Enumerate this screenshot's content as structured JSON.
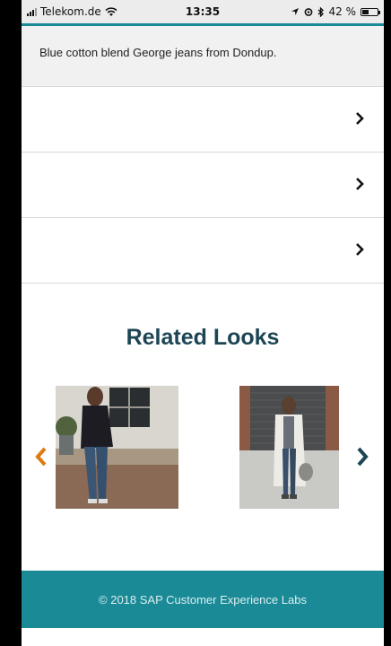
{
  "status_bar": {
    "carrier": "Telekom.de",
    "time": "13:35",
    "battery_text": "42 %",
    "battery_level": 0.42
  },
  "product": {
    "description": "Blue cotton blend George jeans from Dondup."
  },
  "accordion": {
    "rows": [
      {
        "icon": "chevron-right-icon"
      },
      {
        "icon": "chevron-right-icon"
      },
      {
        "icon": "chevron-right-icon"
      }
    ]
  },
  "related": {
    "title": "Related Looks",
    "prev_icon": "chevron-left-icon",
    "next_icon": "chevron-right-icon",
    "prev_color": "#e07a10",
    "next_color": "#1d4554"
  },
  "footer": {
    "copyright": "© 2018 SAP Customer Experience Labs"
  },
  "colors": {
    "accent": "#1a8a96",
    "heading": "#1d4554"
  }
}
